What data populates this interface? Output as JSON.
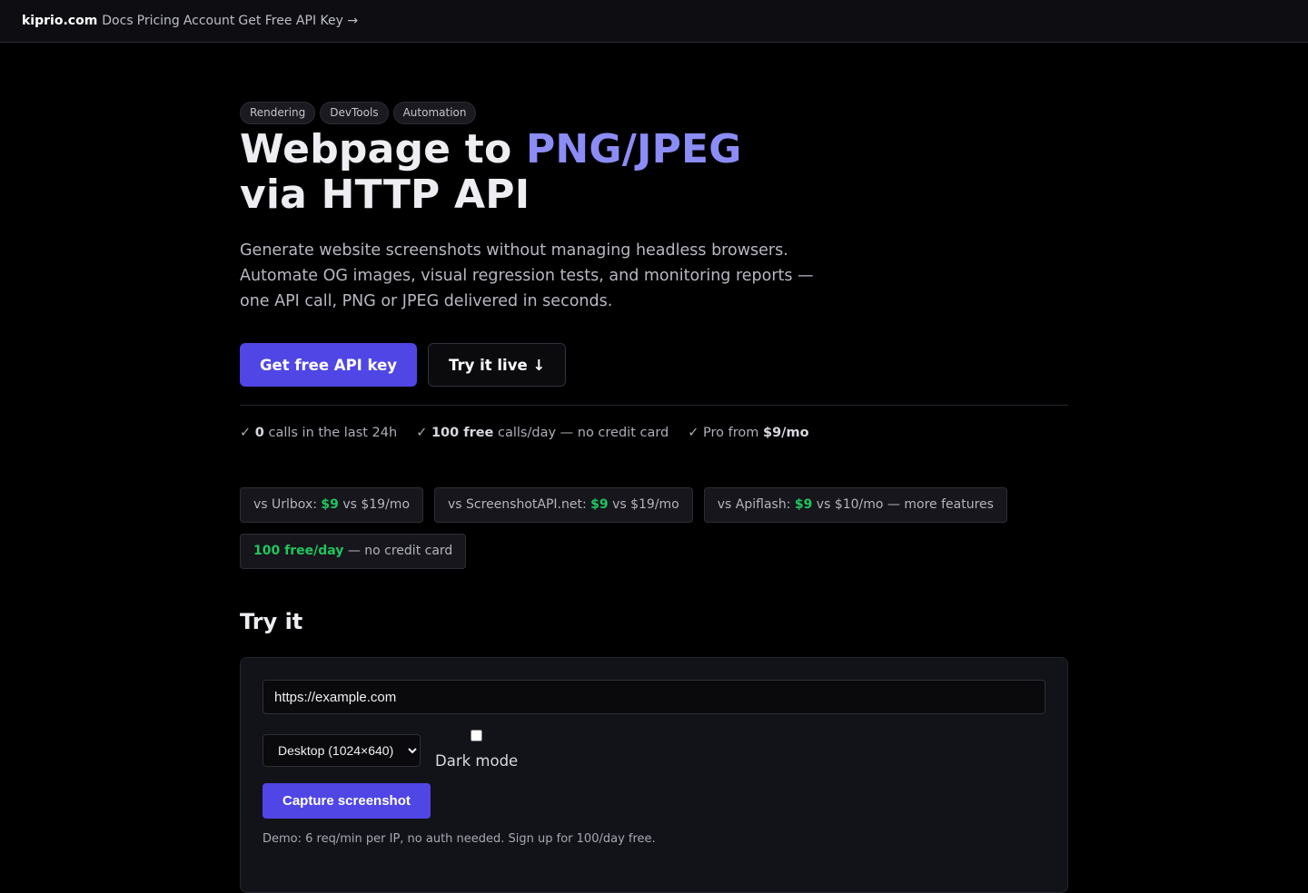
{
  "nav": {
    "brand": "kiprio.com",
    "links": [
      "Docs",
      "Pricing",
      "Account",
      "Get Free API Key →"
    ]
  },
  "hero": {
    "tags": [
      "Rendering",
      "DevTools",
      "Automation"
    ],
    "title_part1": "Webpage to ",
    "title_accent": "PNG/JPEG",
    "title_line2": "via HTTP API",
    "lead": "Generate website screenshots without managing headless browsers. Automate OG images, visual regression tests, and monitoring reports — one API call, PNG or JPEG delivered in seconds.",
    "primary_cta": "Get free API key",
    "secondary_cta": "Try it live ↓"
  },
  "stats": [
    {
      "check": "✓",
      "bold": "0",
      "text": " calls in the last 24h"
    },
    {
      "check": "✓",
      "bold": "100 free",
      "text": " calls/day — no credit card"
    },
    {
      "check": "✓",
      "pre": " Pro from ",
      "bold": "$9/mo"
    }
  ],
  "compare": [
    {
      "pre": "vs Urlbox: ",
      "green": "$9",
      "post": " vs $19/mo"
    },
    {
      "pre": "vs ScreenshotAPI.net: ",
      "green": "$9",
      "post": " vs $19/mo"
    },
    {
      "pre": "vs Apiflash: ",
      "green": "$9",
      "post": " vs $10/mo — more features"
    },
    {
      "pre": "",
      "green": "100 free/day",
      "post": " — no credit card"
    }
  ],
  "try_it": {
    "heading": "Try it",
    "url_value": "https://example.com",
    "viewport_selected": "Desktop (1024×640)",
    "dark_mode_label": "Dark mode",
    "dark_mode_checked": false,
    "capture_label": "Capture screenshot",
    "note": "Demo: 6 req/min per IP, no auth needed. Sign up for 100/day free."
  },
  "colors": {
    "accent": "#8b8cf6",
    "primary": "#5046e5",
    "green": "#22c55e",
    "bg": "#000000"
  }
}
